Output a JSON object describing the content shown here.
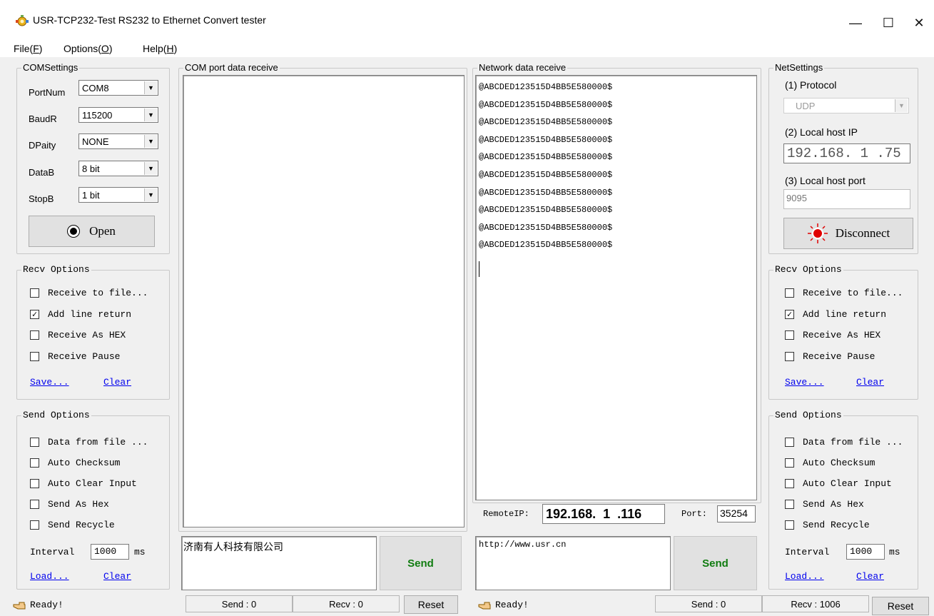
{
  "window": {
    "title": "USR-TCP232-Test  RS232 to Ethernet Convert tester",
    "minimize": "—",
    "maximize": "☐",
    "close": "✕"
  },
  "menu": {
    "file": "File(",
    "file_key": "F",
    "options": "Options(",
    "options_key": "O",
    "help": "Help(",
    "help_key": "H",
    "close_paren": ")"
  },
  "com_settings": {
    "title": "COMSettings",
    "port_label": "PortNum",
    "port_value": "COM8",
    "baud_label": "BaudR",
    "baud_value": "115200",
    "parity_label": "DPaity",
    "parity_value": "NONE",
    "data_label": "DataB",
    "data_value": "8 bit",
    "stop_label": "StopB",
    "stop_value": "1 bit",
    "open_label": "Open"
  },
  "left_recv": {
    "title": "Recv Options",
    "receive_to_file": "Receive to file...",
    "add_line_return": "Add line return",
    "receive_as_hex": "Receive As HEX",
    "receive_pause": "Receive Pause",
    "save": "Save...",
    "clear": "Clear"
  },
  "left_send": {
    "title": "Send Options",
    "data_from_file": "Data from file ...",
    "auto_checksum": "Auto Checksum",
    "auto_clear_input": "Auto Clear Input",
    "send_as_hex": "Send As Hex",
    "send_recycle": "Send Recycle",
    "interval_label": "Interval",
    "interval_value": "1000",
    "interval_unit": "ms",
    "load": "Load...",
    "clear": "Clear"
  },
  "com_receive": {
    "title": "COM port data receive"
  },
  "com_send": {
    "text": "济南有人科技有限公司",
    "send_label": "Send"
  },
  "net_receive": {
    "title": "Network data receive",
    "lines": [
      "@ABCDED123515D4BB5E580000$",
      "@ABCDED123515D4BB5E580000$",
      "@ABCDED123515D4BB5E580000$",
      "@ABCDED123515D4BB5E580000$",
      "@ABCDED123515D4BB5E580000$",
      "@ABCDED123515D4BB5E580000$",
      "@ABCDED123515D4BB5E580000$",
      "@ABCDED123515D4BB5E580000$",
      "@ABCDED123515D4BB5E580000$",
      "@ABCDED123515D4BB5E580000$"
    ],
    "remote_ip_label": "RemoteIP:",
    "remote_ip": [
      "192",
      "168",
      "1",
      "116"
    ],
    "port_label": "Port:",
    "port_value": "35254"
  },
  "net_send": {
    "text": "http://www.usr.cn",
    "send_label": "Send"
  },
  "net_settings": {
    "title": "NetSettings",
    "protocol_label": "(1) Protocol",
    "protocol_value": "UDP",
    "local_ip_label": "(2) Local host IP",
    "local_ip": [
      "192",
      "168",
      "1",
      "75"
    ],
    "local_port_label": "(3) Local host port",
    "local_port_value": "9095",
    "disconnect_label": "Disconnect"
  },
  "right_recv": {
    "title": "Recv Options",
    "receive_to_file": "Receive to file...",
    "add_line_return": "Add line return",
    "receive_as_hex": "Receive As HEX",
    "receive_pause": "Receive Pause",
    "save": "Save...",
    "clear": "Clear"
  },
  "right_send": {
    "title": "Send Options",
    "data_from_file": "Data from file ...",
    "auto_checksum": "Auto Checksum",
    "auto_clear_input": "Auto Clear Input",
    "send_as_hex": "Send As Hex",
    "send_recycle": "Send Recycle",
    "interval_label": "Interval",
    "interval_value": "1000",
    "interval_unit": "ms",
    "load": "Load...",
    "clear": "Clear"
  },
  "status": {
    "left_ready": "Ready!",
    "com_send": "Send : 0",
    "com_recv": "Recv : 0",
    "com_reset": "Reset",
    "net_ready": "Ready!",
    "net_send": "Send : 0",
    "net_recv": "Recv : 1006",
    "net_reset": "Reset"
  },
  "colors": {
    "send_text": "#107c10",
    "link": "#0000ee",
    "led_red": "#e00000"
  }
}
